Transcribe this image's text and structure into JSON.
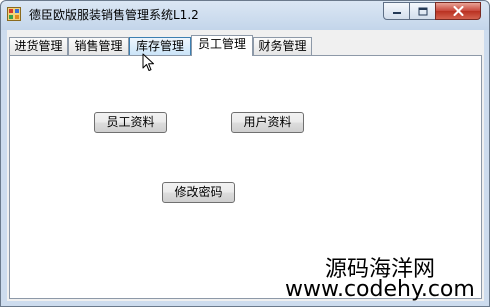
{
  "window": {
    "title": "德臣欧版服装销售管理系统L1.2"
  },
  "tabs": [
    {
      "label": "进货管理"
    },
    {
      "label": "销售管理"
    },
    {
      "label": "库存管理"
    },
    {
      "label": "员工管理"
    },
    {
      "label": "财务管理"
    }
  ],
  "active_tab": "员工管理",
  "buttons": {
    "employee_info": "员工资料",
    "user_info": "用户资料",
    "change_password": "修改密码"
  },
  "watermark": {
    "line1": "源码海洋网",
    "line2": "www.codehy.com"
  },
  "icons": {
    "app": "app-icon",
    "minimize": "minimize-icon",
    "maximize": "maximize-icon",
    "close": "close-icon",
    "cursor": "mouse-cursor-icon"
  },
  "colors": {
    "close_button": "#c8463a",
    "tab_hover": "#cbe4f8"
  }
}
